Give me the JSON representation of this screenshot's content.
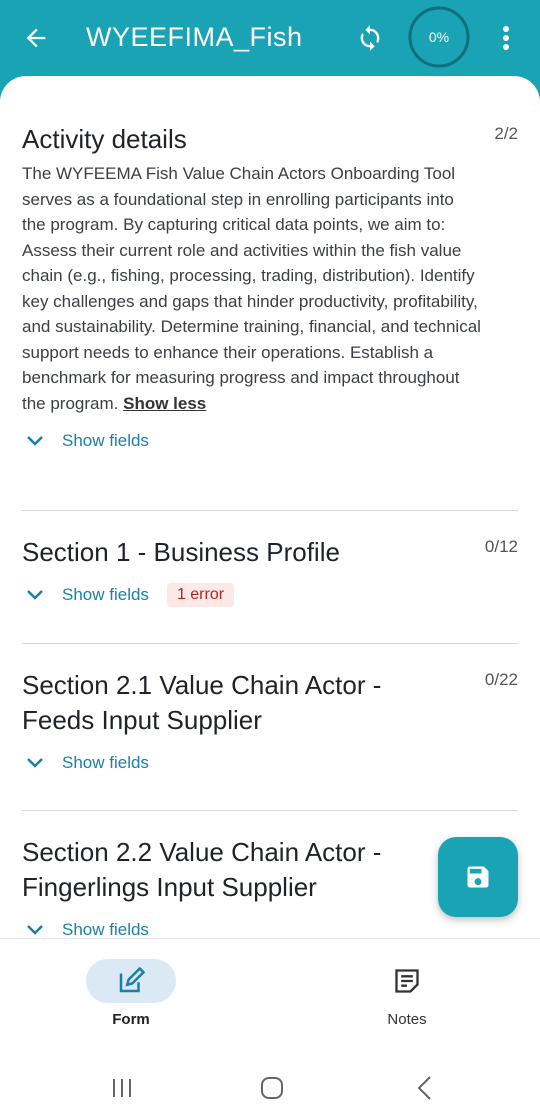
{
  "appbar": {
    "title": "WYEEFIMA_Fish",
    "progress": "0%",
    "progress_value": 0,
    "icons": [
      "back-arrow-icon",
      "sync-icon",
      "more-vert-icon"
    ],
    "color": "#1aa3b5"
  },
  "activity": {
    "title": "Activity details",
    "count": "2/2",
    "description": "The WYFEEMA Fish Value Chain Actors Onboarding Tool serves as a foundational step in enrolling participants into the program. By capturing critical data points, we aim to: Assess their current role and activities within the fish value chain (e.g., fishing, processing, trading, distribution). Identify key challenges and gaps that hinder productivity, profitability, and sustainability. Determine training, financial, and technical support needs to enhance their operations. Establish a benchmark for measuring progress and impact throughout the program.",
    "show_less": "Show less",
    "show_fields": "Show fields"
  },
  "sections": [
    {
      "title": "Section 1 - Business Profile",
      "count": "0/12",
      "show_fields": "Show fields",
      "error": "1 error"
    },
    {
      "title": "Section 2.1 Value Chain Actor - Feeds Input Supplier",
      "count": "0/22",
      "show_fields": "Show fields"
    },
    {
      "title": "Section 2.2 Value Chain Actor - Fingerlings Input Supplier",
      "show_fields": "Show fields"
    }
  ],
  "bottom_nav": {
    "form_label": "Form",
    "notes_label": "Notes"
  },
  "colors": {
    "accent": "#1aa3b5",
    "link": "#1b7fa8",
    "error": "#b3261e",
    "error_bg": "#fde8e8"
  }
}
